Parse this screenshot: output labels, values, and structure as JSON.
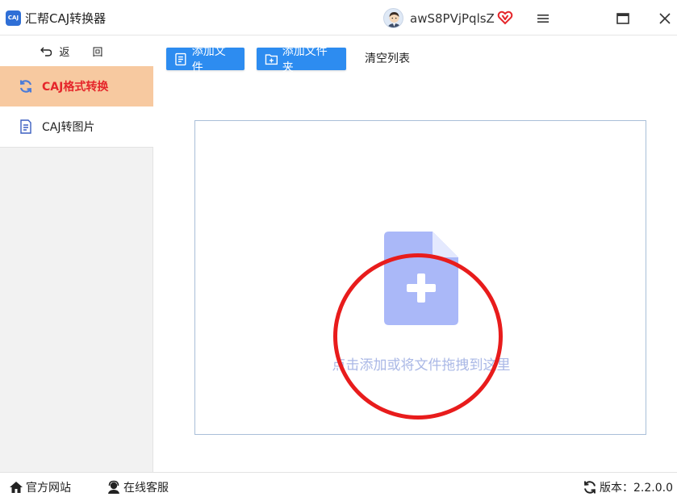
{
  "app": {
    "logo_text": "CAJ",
    "title": "汇帮CAJ转换器",
    "username": "awS8PVjPqlsZ",
    "accent_color": "#2d8cf0",
    "active_color": "#e5262b"
  },
  "sidebar": {
    "back_label": "返 回",
    "items": [
      {
        "label": "CAJ格式转换",
        "icon": "refresh-icon",
        "active": true
      },
      {
        "label": "CAJ转图片",
        "icon": "document-icon",
        "active": false
      }
    ]
  },
  "toolbar": {
    "add_file_label": "添加文件",
    "add_folder_label": "添加文件夹",
    "clear_label": "清空列表"
  },
  "dropzone": {
    "hint": "点击添加或将文件拖拽到这里"
  },
  "statusbar": {
    "site_label": "官方网站",
    "service_label": "在线客服",
    "version_label": "版本：2.2.0.0"
  }
}
